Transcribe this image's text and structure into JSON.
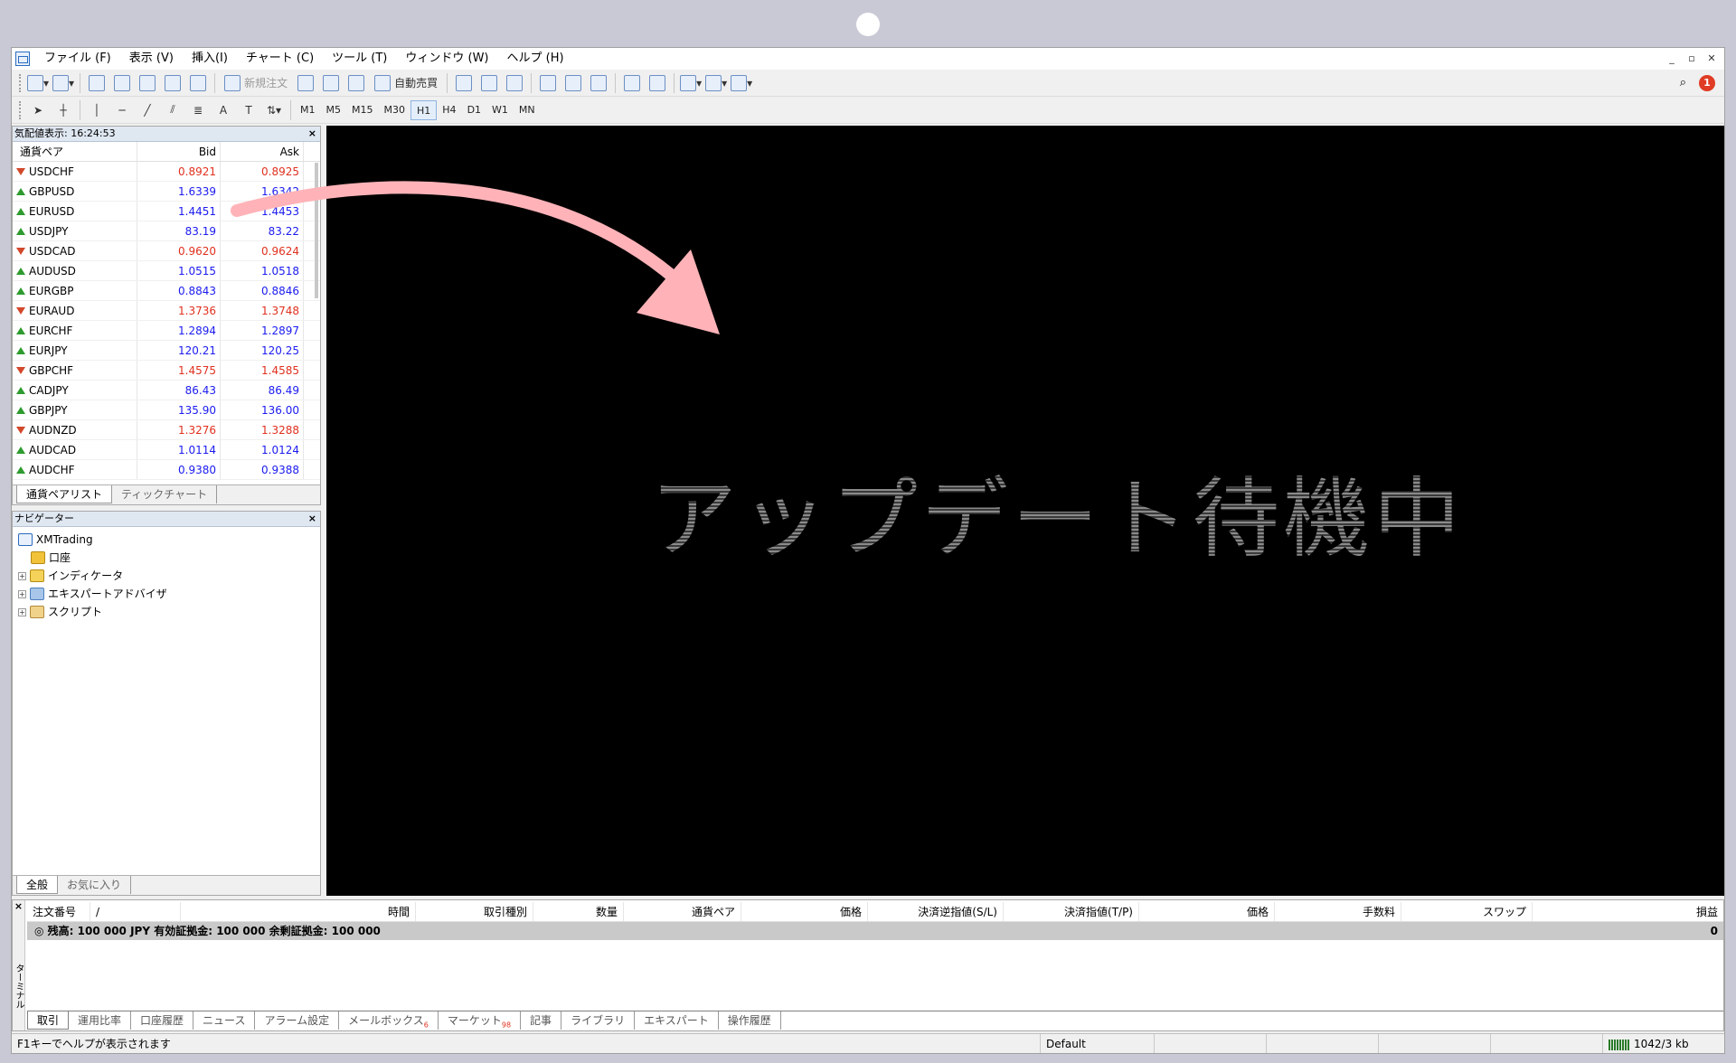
{
  "menubar": {
    "items": [
      "ファイル (F)",
      "表示 (V)",
      "挿入(I)",
      "チャート (C)",
      "ツール (T)",
      "ウィンドウ (W)",
      "ヘルプ (H)"
    ]
  },
  "toolbar": {
    "new_order": "新規注文",
    "auto_trade": "自動売買",
    "notification_count": "1",
    "timeframes": [
      "M1",
      "M5",
      "M15",
      "M30",
      "H1",
      "H4",
      "D1",
      "W1",
      "MN"
    ],
    "active_timeframe": "H1"
  },
  "market_watch": {
    "title": "気配値表示: 16:24:53",
    "col_symbol": "通貨ペア",
    "col_bid": "Bid",
    "col_ask": "Ask",
    "rows": [
      {
        "symbol": "USDCHF",
        "bid": "0.8921",
        "ask": "0.8925",
        "dir": "down"
      },
      {
        "symbol": "GBPUSD",
        "bid": "1.6339",
        "ask": "1.6342",
        "dir": "up"
      },
      {
        "symbol": "EURUSD",
        "bid": "1.4451",
        "ask": "1.4453",
        "dir": "up"
      },
      {
        "symbol": "USDJPY",
        "bid": "83.19",
        "ask": "83.22",
        "dir": "up"
      },
      {
        "symbol": "USDCAD",
        "bid": "0.9620",
        "ask": "0.9624",
        "dir": "down"
      },
      {
        "symbol": "AUDUSD",
        "bid": "1.0515",
        "ask": "1.0518",
        "dir": "up"
      },
      {
        "symbol": "EURGBP",
        "bid": "0.8843",
        "ask": "0.8846",
        "dir": "up"
      },
      {
        "symbol": "EURAUD",
        "bid": "1.3736",
        "ask": "1.3748",
        "dir": "down"
      },
      {
        "symbol": "EURCHF",
        "bid": "1.2894",
        "ask": "1.2897",
        "dir": "up"
      },
      {
        "symbol": "EURJPY",
        "bid": "120.21",
        "ask": "120.25",
        "dir": "up"
      },
      {
        "symbol": "GBPCHF",
        "bid": "1.4575",
        "ask": "1.4585",
        "dir": "down"
      },
      {
        "symbol": "CADJPY",
        "bid": "86.43",
        "ask": "86.49",
        "dir": "up"
      },
      {
        "symbol": "GBPJPY",
        "bid": "135.90",
        "ask": "136.00",
        "dir": "up"
      },
      {
        "symbol": "AUDNZD",
        "bid": "1.3276",
        "ask": "1.3288",
        "dir": "down"
      },
      {
        "symbol": "AUDCAD",
        "bid": "1.0114",
        "ask": "1.0124",
        "dir": "up"
      },
      {
        "symbol": "AUDCHF",
        "bid": "0.9380",
        "ask": "0.9388",
        "dir": "up"
      }
    ],
    "tabs": [
      "通貨ペアリスト",
      "ティックチャート"
    ]
  },
  "navigator": {
    "title": "ナビゲーター",
    "root": "XMTrading",
    "items": [
      "口座",
      "インディケータ",
      "エキスパートアドバイザ",
      "スクリプト"
    ],
    "tabs": [
      "全般",
      "お気に入り"
    ]
  },
  "chart": {
    "message": "アップデート待機中"
  },
  "terminal": {
    "side_label": "ターミナル",
    "columns": [
      "注文番号",
      "/",
      "時間",
      "取引種別",
      "数量",
      "通貨ペア",
      "価格",
      "決済逆指値(S/L)",
      "決済指値(T/P)",
      "価格",
      "手数料",
      "スワップ",
      "損益"
    ],
    "balance_text": "残高: 100 000 JPY  有効証拠金: 100 000  余剰証拠金: 100 000",
    "balance_value": "0",
    "tabs": [
      "取引",
      "運用比率",
      "口座履歴",
      "ニュース",
      "アラーム設定",
      "メールボックス",
      "マーケット",
      "記事",
      "ライブラリ",
      "エキスパート",
      "操作履歴"
    ],
    "mailbox_count": "6",
    "market_count": "98"
  },
  "statusbar": {
    "help": "F1キーでヘルプが表示されます",
    "profile": "Default",
    "traffic": "1042/3 kb"
  },
  "colors": {
    "accent_arrow": "#ffb3b8",
    "bid_down": "#e0301e",
    "bid_up": "#1b1bf0"
  }
}
